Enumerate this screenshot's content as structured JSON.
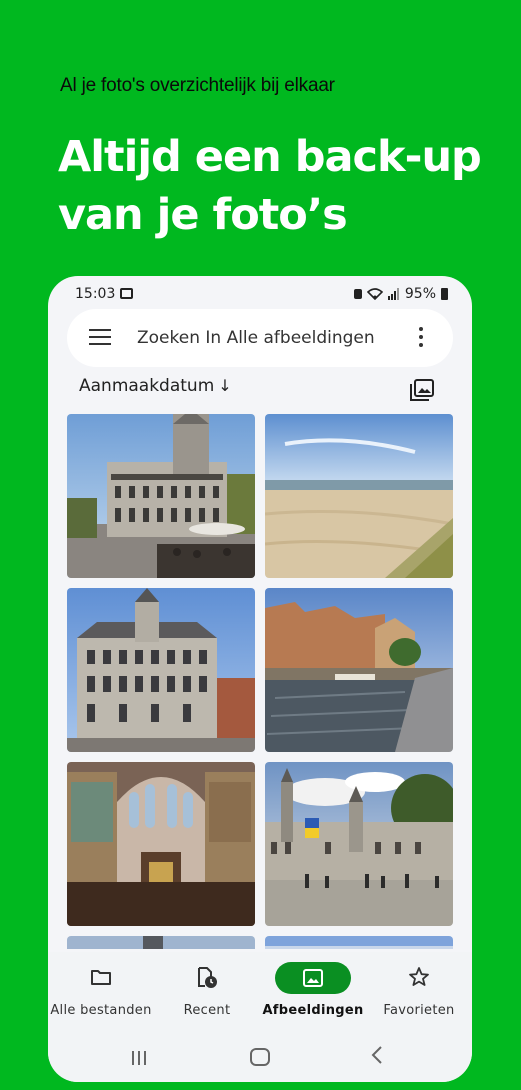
{
  "promo": {
    "subtitle": "Al je foto's overzichtelijk bij elkaar",
    "title": "Altijd een back-up van je foto’s"
  },
  "statusbar": {
    "time": "15:03",
    "battery": "95%"
  },
  "search": {
    "text": "Zoeken In Alle afbeeldingen"
  },
  "sort": {
    "label": "Aanmaakdatum",
    "arrow": "↓"
  },
  "photos": [
    {
      "subject": "town-hall-square"
    },
    {
      "subject": "beach-dunes"
    },
    {
      "subject": "town-hall-facade"
    },
    {
      "subject": "canal-houses"
    },
    {
      "subject": "church-interior"
    },
    {
      "subject": "market-square-belfry"
    }
  ],
  "nav": {
    "items": [
      {
        "label": "Alle bestanden",
        "icon": "folder-icon",
        "active": false
      },
      {
        "label": "Recent",
        "icon": "recent-file-icon",
        "active": false
      },
      {
        "label": "Afbeeldingen",
        "icon": "image-icon",
        "active": true
      },
      {
        "label": "Favorieten",
        "icon": "star-icon",
        "active": false
      }
    ]
  },
  "colors": {
    "background": "#00b81f",
    "active_nav": "#0a8f22",
    "title_text": "#ffffff"
  }
}
